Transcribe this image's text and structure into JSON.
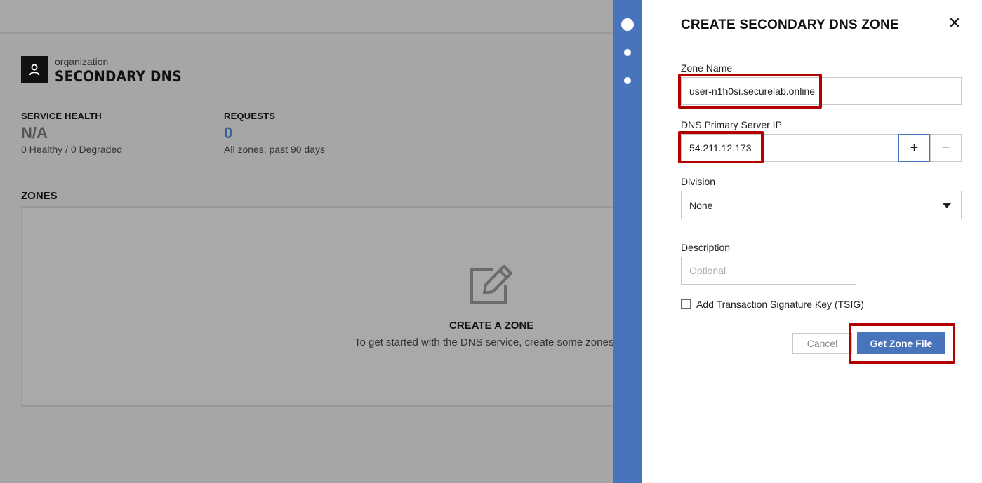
{
  "background": {
    "org": {
      "subtitle": "organization",
      "title": "SECONDARY DNS",
      "icon": "user-icon"
    },
    "stats": {
      "health": {
        "label": "SERVICE HEALTH",
        "value": "N/A",
        "sub": "0 Healthy / 0 Degraded"
      },
      "requests": {
        "label": "REQUESTS",
        "value": "0",
        "sub": "All zones, past 90 days"
      }
    },
    "zones": {
      "label": "ZONES",
      "empty_icon": "edit-icon",
      "empty_title": "CREATE A ZONE",
      "empty_text": "To get started with the DNS service, create some zones."
    }
  },
  "drawer": {
    "title": "CREATE SECONDARY DNS ZONE",
    "close_icon": "close-icon",
    "zone_name": {
      "label": "Zone Name",
      "value": "user-n1h0si.securelab.online"
    },
    "primary_ip": {
      "label": "DNS Primary Server IP",
      "value": "54.211.12.173",
      "add": "+",
      "remove": "−"
    },
    "division": {
      "label": "Division",
      "selected": "None"
    },
    "description": {
      "label": "Description",
      "placeholder": "Optional"
    },
    "tsig": {
      "label": "Add Transaction Signature Key (TSIG)",
      "checked": false
    },
    "cancel_label": "Cancel",
    "submit_label": "Get Zone File"
  },
  "colors": {
    "accent": "#4774bb",
    "highlight": "#b20000",
    "overlay": "#a6a6a6",
    "requests_value": "#3b5f99",
    "health_value": "#555555"
  }
}
